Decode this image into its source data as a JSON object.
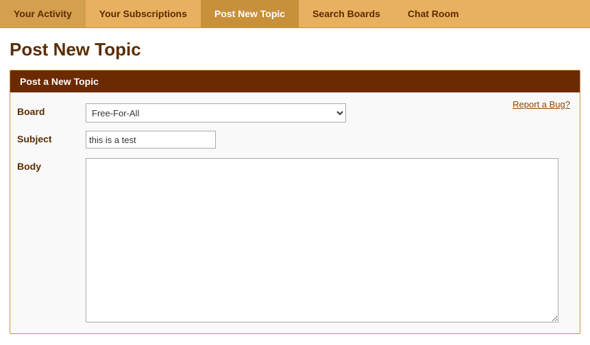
{
  "nav": {
    "items": [
      {
        "label": "Your Activity",
        "active": false
      },
      {
        "label": "Your Subscriptions",
        "active": false
      },
      {
        "label": "Post New Topic",
        "active": true
      },
      {
        "label": "Search Boards",
        "active": false
      },
      {
        "label": "Chat Room",
        "active": false
      }
    ]
  },
  "page": {
    "title": "Post New Topic",
    "card_header": "Post a New Topic",
    "report_bug": "Report a Bug?",
    "labels": {
      "board": "Board",
      "subject": "Subject",
      "body": "Body"
    },
    "board_options": [
      {
        "value": "free-for-all",
        "label": "Free-For-All"
      }
    ],
    "subject_value": "this is a test",
    "body_value": ""
  }
}
